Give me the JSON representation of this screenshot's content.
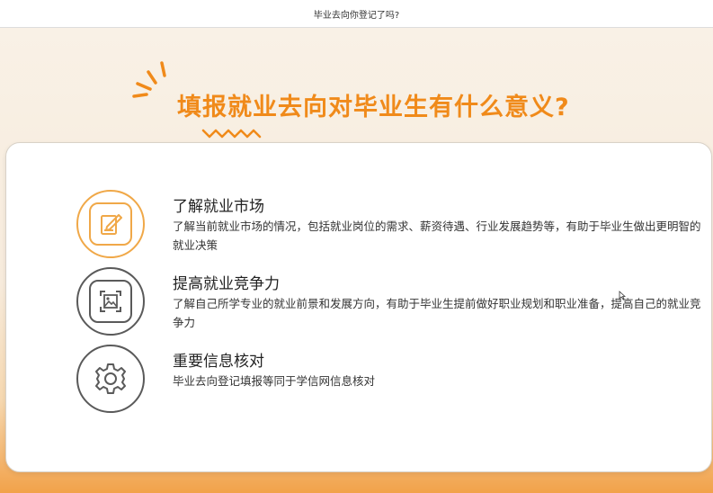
{
  "window": {
    "title": "毕业去向你登记了吗?"
  },
  "slide": {
    "heading": "填报就业去向对毕业生有什么意义?",
    "items": [
      {
        "title": "了解就业市场",
        "desc": "了解当前就业市场的情况，包括就业岗位的需求、薪资待遇、行业发展趋势等，有助于毕业生做出更明智的就业决策",
        "icon": "document-pen-icon"
      },
      {
        "title": "提高就业竞争力",
        "desc": "了解自己所学专业的就业前景和发展方向，有助于毕业生提前做好职业规划和职业准备，提高自己的就业竞争力",
        "icon": "image-frame-icon"
      },
      {
        "title": "重要信息核对",
        "desc": "毕业去向登记填报等同于学信网信息核对",
        "icon": "gear-icon"
      }
    ]
  },
  "colors": {
    "accent": "#f08a1a",
    "icon_orange": "#f0a848",
    "icon_gray": "#5a5a5a"
  }
}
